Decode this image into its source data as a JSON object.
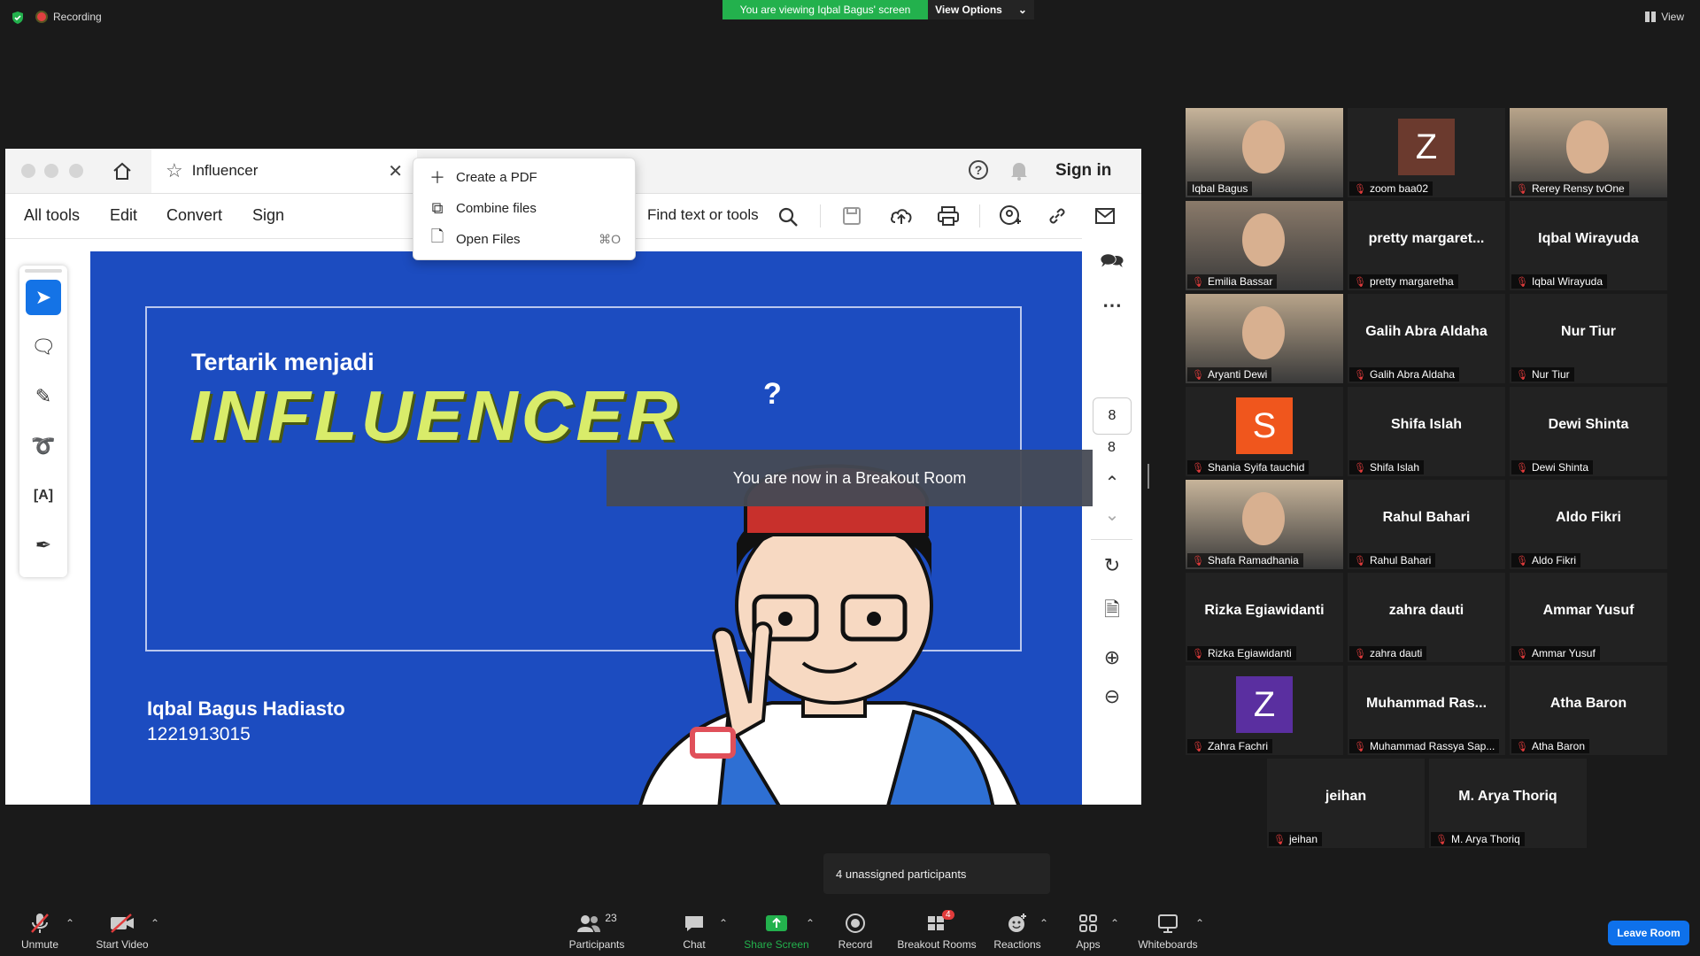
{
  "top": {
    "recording": "Recording",
    "viewing_banner": "You are viewing Iqbal Bagus' screen",
    "view_options": "View Options",
    "view": "View"
  },
  "acrobat": {
    "tab_title": "Influencer",
    "sign_in": "Sign in",
    "menu": [
      "All tools",
      "Edit",
      "Convert",
      "Sign"
    ],
    "find_placeholder": "Find text or tools",
    "dropdown": [
      {
        "label": "Create a PDF",
        "shortcut": "",
        "icon": "plus-icon"
      },
      {
        "label": "Combine files",
        "shortcut": "",
        "icon": "combine-icon"
      },
      {
        "label": "Open Files",
        "shortcut": "⌘O",
        "icon": "open-file-icon"
      }
    ],
    "page_number": "8",
    "page_total": "8"
  },
  "slide": {
    "subtitle": "Tertarik menjadi",
    "title": "INFLUENCER",
    "question_mark": "?",
    "author_name": "Iqbal Bagus Hadiasto",
    "author_id": "1221913015"
  },
  "breakout_toast": "You are now in a Breakout Room",
  "participants": [
    {
      "label": "Iqbal Bagus",
      "name": "",
      "kind": "photo",
      "active": true,
      "muted": false
    },
    {
      "label": "zoom baa02",
      "name": "",
      "kind": "avatar",
      "avatar_letter": "Z",
      "avatar_color": "#6b3a2e",
      "muted": true
    },
    {
      "label": "Rerey Rensy tvOne",
      "name": "",
      "kind": "photo",
      "muted": true
    },
    {
      "label": "Emilia Bassar",
      "name": "",
      "kind": "photo",
      "muted": true
    },
    {
      "label": "pretty margaretha",
      "name": "pretty margaret...",
      "kind": "name",
      "muted": true
    },
    {
      "label": "Iqbal Wirayuda",
      "name": "Iqbal Wirayuda",
      "kind": "name",
      "muted": true
    },
    {
      "label": "Aryanti Dewi",
      "name": "",
      "kind": "photo",
      "muted": true
    },
    {
      "label": "Galih Abra Aldaha",
      "name": "Galih Abra Aldaha",
      "kind": "name",
      "muted": true
    },
    {
      "label": "Nur Tiur",
      "name": "Nur Tiur",
      "kind": "name",
      "muted": true
    },
    {
      "label": "Shania Syifa tauchid",
      "name": "",
      "kind": "avatar",
      "avatar_letter": "S",
      "avatar_color": "#f0561d",
      "muted": true
    },
    {
      "label": "Shifa Islah",
      "name": "Shifa Islah",
      "kind": "name",
      "muted": true
    },
    {
      "label": "Dewi Shinta",
      "name": "Dewi Shinta",
      "kind": "name",
      "muted": true
    },
    {
      "label": "Shafa Ramadhania",
      "name": "",
      "kind": "photo",
      "muted": true
    },
    {
      "label": "Rahul Bahari",
      "name": "Rahul Bahari",
      "kind": "name",
      "muted": true
    },
    {
      "label": "Aldo Fikri",
      "name": "Aldo Fikri",
      "kind": "name",
      "muted": true
    },
    {
      "label": "Rizka Egiawidanti",
      "name": "Rizka Egiawidanti",
      "kind": "name",
      "muted": true
    },
    {
      "label": "zahra dauti",
      "name": "zahra dauti",
      "kind": "name",
      "muted": true
    },
    {
      "label": "Ammar Yusuf",
      "name": "Ammar Yusuf",
      "kind": "name",
      "muted": true
    },
    {
      "label": "Zahra Fachri",
      "name": "",
      "kind": "avatar",
      "avatar_letter": "Z",
      "avatar_color": "#5a2fa0",
      "muted": true
    },
    {
      "label": "Muhammad Rassya Sap...",
      "name": "Muhammad  Ras...",
      "kind": "name",
      "muted": true
    },
    {
      "label": "Atha Baron",
      "name": "Atha Baron",
      "kind": "name",
      "muted": true
    },
    {
      "label": "jeihan",
      "name": "jeihan",
      "kind": "name",
      "muted": true
    },
    {
      "label": "M. Arya Thoriq",
      "name": "M. Arya Thoriq",
      "kind": "name",
      "muted": true
    }
  ],
  "unassigned": "4 unassigned participants",
  "toolbar": {
    "unmute": "Unmute",
    "start_video": "Start Video",
    "participants": "Participants",
    "participants_count": "23",
    "chat": "Chat",
    "share_screen": "Share Screen",
    "record": "Record",
    "breakout_rooms": "Breakout Rooms",
    "breakout_badge": "4",
    "reactions": "Reactions",
    "apps": "Apps",
    "whiteboards": "Whiteboards",
    "leave_room": "Leave Room"
  },
  "colors": {
    "share_green": "#23b14d",
    "leave_blue": "#0e71eb",
    "slide_blue": "#1c4cc0",
    "mute_red": "#e03b3b"
  }
}
